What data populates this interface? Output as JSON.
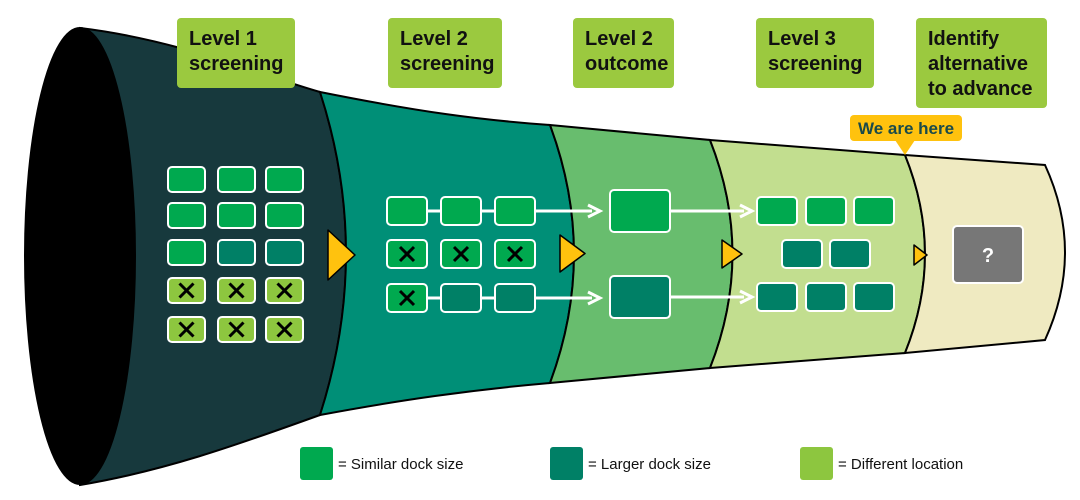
{
  "stages": [
    {
      "line1": "Level 1",
      "line2": "screening"
    },
    {
      "line1": "Level 2",
      "line2": "screening"
    },
    {
      "line1": "Level 2",
      "line2": "outcome"
    },
    {
      "line1": "Level 3",
      "line2": "screening"
    },
    {
      "line1": "Identify",
      "line2": "alternative",
      "line3": "to advance"
    }
  ],
  "marker": "We are here",
  "unknown": "?",
  "legend": [
    {
      "label": "= Similar dock size",
      "color": "#00a94f"
    },
    {
      "label": "= Larger dock size",
      "color": "#008066"
    },
    {
      "label": "= Different location",
      "color": "#8dc63f"
    }
  ],
  "colors": {
    "section1": "#17393d",
    "section2": "#008f77",
    "section3": "#68bd6e",
    "section4": "#c2de8f",
    "section5": "#efeac1",
    "label": "#9bc93f",
    "marker": "#ffc20e",
    "unknown": "#777777"
  }
}
